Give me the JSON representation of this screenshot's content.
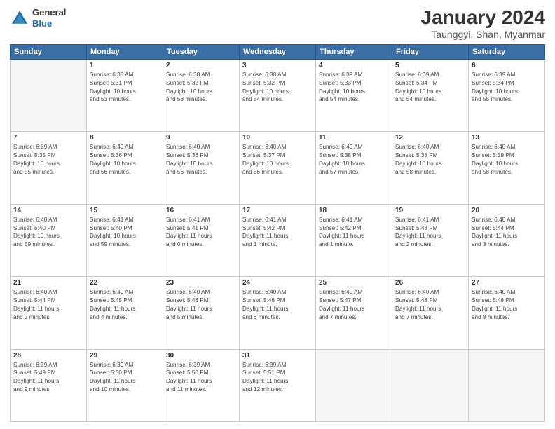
{
  "header": {
    "logo_line1": "General",
    "logo_line2": "Blue",
    "title": "January 2024",
    "subtitle": "Taunggyi, Shan, Myanmar"
  },
  "days": [
    "Sunday",
    "Monday",
    "Tuesday",
    "Wednesday",
    "Thursday",
    "Friday",
    "Saturday"
  ],
  "weeks": [
    [
      {
        "date": "",
        "info": ""
      },
      {
        "date": "1",
        "info": "Sunrise: 6:38 AM\nSunset: 5:31 PM\nDaylight: 10 hours\nand 53 minutes."
      },
      {
        "date": "2",
        "info": "Sunrise: 6:38 AM\nSunset: 5:32 PM\nDaylight: 10 hours\nand 53 minutes."
      },
      {
        "date": "3",
        "info": "Sunrise: 6:38 AM\nSunset: 5:32 PM\nDaylight: 10 hours\nand 54 minutes."
      },
      {
        "date": "4",
        "info": "Sunrise: 6:39 AM\nSunset: 5:33 PM\nDaylight: 10 hours\nand 54 minutes."
      },
      {
        "date": "5",
        "info": "Sunrise: 6:39 AM\nSunset: 5:34 PM\nDaylight: 10 hours\nand 54 minutes."
      },
      {
        "date": "6",
        "info": "Sunrise: 6:39 AM\nSunset: 5:34 PM\nDaylight: 10 hours\nand 55 minutes."
      }
    ],
    [
      {
        "date": "7",
        "info": "Sunrise: 6:39 AM\nSunset: 5:35 PM\nDaylight: 10 hours\nand 55 minutes."
      },
      {
        "date": "8",
        "info": "Sunrise: 6:40 AM\nSunset: 5:36 PM\nDaylight: 10 hours\nand 56 minutes."
      },
      {
        "date": "9",
        "info": "Sunrise: 6:40 AM\nSunset: 5:36 PM\nDaylight: 10 hours\nand 56 minutes."
      },
      {
        "date": "10",
        "info": "Sunrise: 6:40 AM\nSunset: 5:37 PM\nDaylight: 10 hours\nand 56 minutes."
      },
      {
        "date": "11",
        "info": "Sunrise: 6:40 AM\nSunset: 5:38 PM\nDaylight: 10 hours\nand 57 minutes."
      },
      {
        "date": "12",
        "info": "Sunrise: 6:40 AM\nSunset: 5:38 PM\nDaylight: 10 hours\nand 58 minutes."
      },
      {
        "date": "13",
        "info": "Sunrise: 6:40 AM\nSunset: 5:39 PM\nDaylight: 10 hours\nand 58 minutes."
      }
    ],
    [
      {
        "date": "14",
        "info": "Sunrise: 6:40 AM\nSunset: 5:40 PM\nDaylight: 10 hours\nand 59 minutes."
      },
      {
        "date": "15",
        "info": "Sunrise: 6:41 AM\nSunset: 5:40 PM\nDaylight: 10 hours\nand 59 minutes."
      },
      {
        "date": "16",
        "info": "Sunrise: 6:41 AM\nSunset: 5:41 PM\nDaylight: 11 hours\nand 0 minutes."
      },
      {
        "date": "17",
        "info": "Sunrise: 6:41 AM\nSunset: 5:42 PM\nDaylight: 11 hours\nand 1 minute."
      },
      {
        "date": "18",
        "info": "Sunrise: 6:41 AM\nSunset: 5:42 PM\nDaylight: 11 hours\nand 1 minute."
      },
      {
        "date": "19",
        "info": "Sunrise: 6:41 AM\nSunset: 5:43 PM\nDaylight: 11 hours\nand 2 minutes."
      },
      {
        "date": "20",
        "info": "Sunrise: 6:40 AM\nSunset: 5:44 PM\nDaylight: 11 hours\nand 3 minutes."
      }
    ],
    [
      {
        "date": "21",
        "info": "Sunrise: 6:40 AM\nSunset: 5:44 PM\nDaylight: 11 hours\nand 3 minutes."
      },
      {
        "date": "22",
        "info": "Sunrise: 6:40 AM\nSunset: 5:45 PM\nDaylight: 11 hours\nand 4 minutes."
      },
      {
        "date": "23",
        "info": "Sunrise: 6:40 AM\nSunset: 5:46 PM\nDaylight: 11 hours\nand 5 minutes."
      },
      {
        "date": "24",
        "info": "Sunrise: 6:40 AM\nSunset: 5:46 PM\nDaylight: 11 hours\nand 6 minutes."
      },
      {
        "date": "25",
        "info": "Sunrise: 6:40 AM\nSunset: 5:47 PM\nDaylight: 11 hours\nand 7 minutes."
      },
      {
        "date": "26",
        "info": "Sunrise: 6:40 AM\nSunset: 5:48 PM\nDaylight: 11 hours\nand 7 minutes."
      },
      {
        "date": "27",
        "info": "Sunrise: 6:40 AM\nSunset: 5:48 PM\nDaylight: 11 hours\nand 8 minutes."
      }
    ],
    [
      {
        "date": "28",
        "info": "Sunrise: 6:39 AM\nSunset: 5:49 PM\nDaylight: 11 hours\nand 9 minutes."
      },
      {
        "date": "29",
        "info": "Sunrise: 6:39 AM\nSunset: 5:50 PM\nDaylight: 11 hours\nand 10 minutes."
      },
      {
        "date": "30",
        "info": "Sunrise: 6:39 AM\nSunset: 5:50 PM\nDaylight: 11 hours\nand 11 minutes."
      },
      {
        "date": "31",
        "info": "Sunrise: 6:39 AM\nSunset: 5:51 PM\nDaylight: 11 hours\nand 12 minutes."
      },
      {
        "date": "",
        "info": ""
      },
      {
        "date": "",
        "info": ""
      },
      {
        "date": "",
        "info": ""
      }
    ]
  ]
}
